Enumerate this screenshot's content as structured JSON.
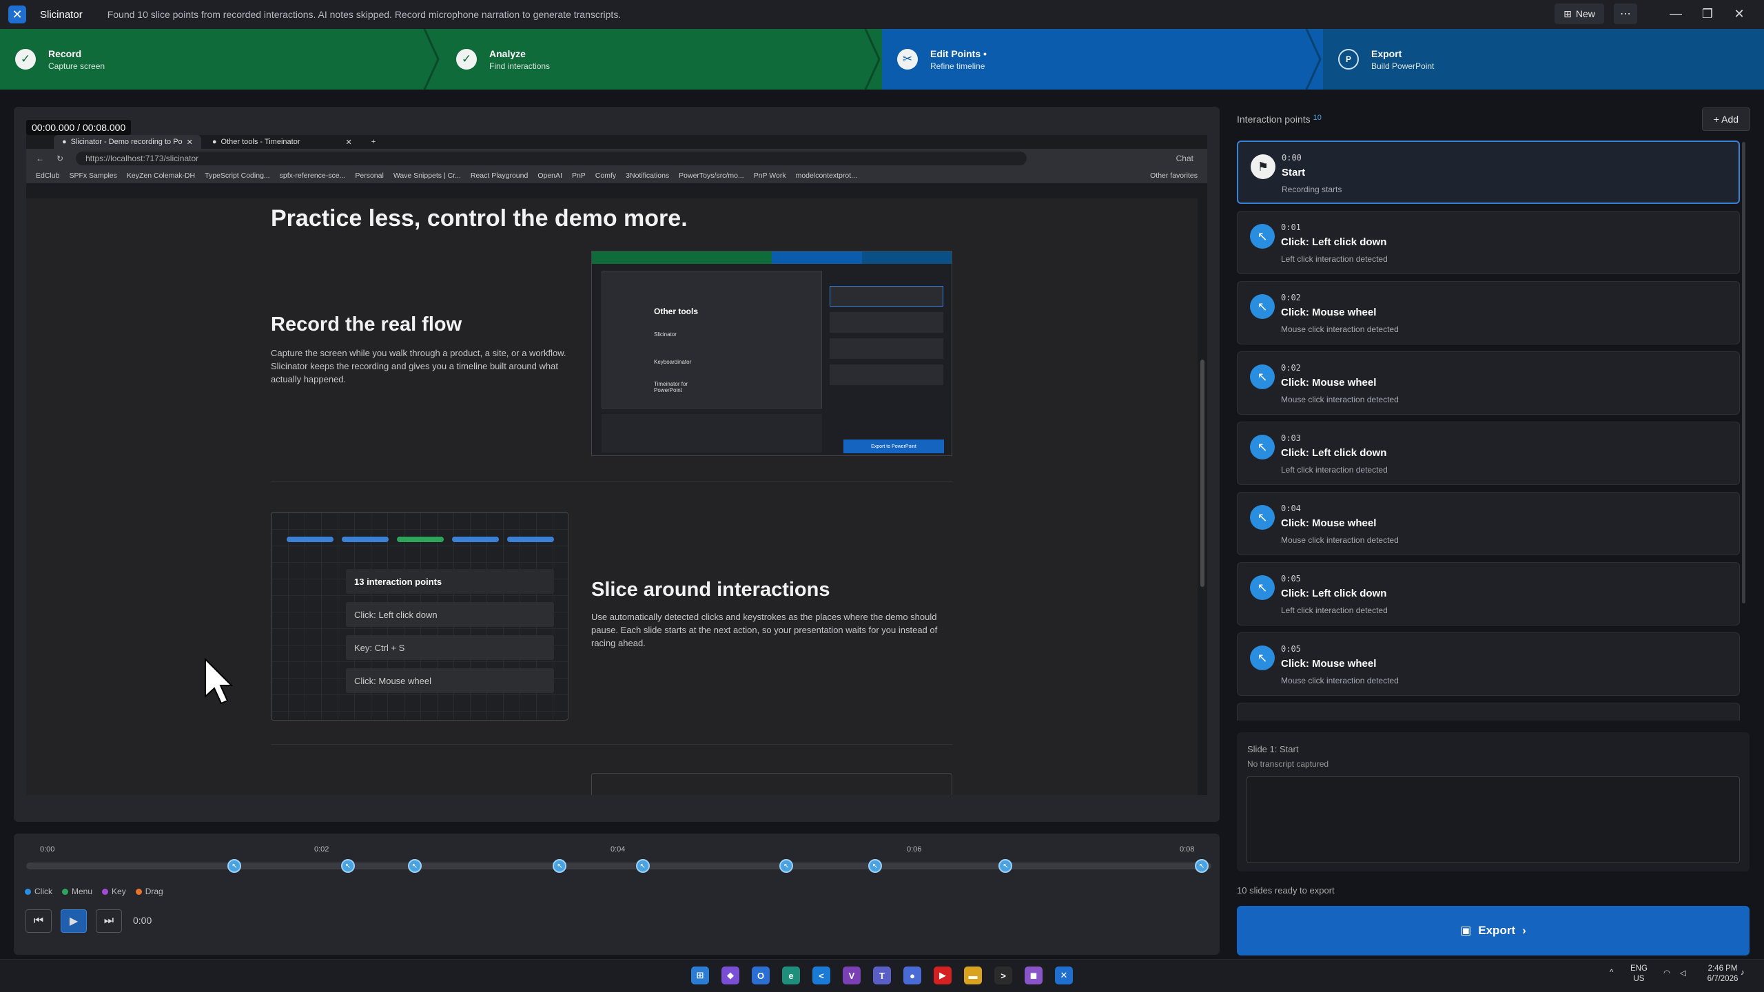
{
  "app": {
    "name": "Slicinator",
    "status": "Found 10 slice points from recorded interactions. AI notes skipped. Record microphone narration to generate transcripts.",
    "new_label": "New",
    "more_label": "⋯"
  },
  "steps": [
    {
      "title": "Record",
      "sub": "Capture screen",
      "icon": "check-icon"
    },
    {
      "title": "Analyze",
      "sub": "Find interactions",
      "icon": "check-icon"
    },
    {
      "title": "Edit Points •",
      "sub": "Refine timeline",
      "icon": "edit-icon"
    },
    {
      "title": "Export",
      "sub": "Build PowerPoint",
      "icon": "powerpoint-icon"
    }
  ],
  "colors": {
    "step_done": "#0f6b3a",
    "step_active": "#0b5cad",
    "step_pending": "#0a4f86",
    "accent": "#1565c0"
  },
  "player": {
    "time": "00:00.000 / 00:08.000"
  },
  "browser": {
    "tabs": [
      "Slicinator - Demo recording to Po",
      "Other tools - Timeinator"
    ],
    "url": "https://localhost:7173/slicinator",
    "favorites": [
      "EdClub",
      "SPFx Samples",
      "KeyZen Colemak-DH",
      "TypeScript Coding...",
      "spfx-reference-sce...",
      "Personal",
      "Wave Snippets | Cr...",
      "React Playground",
      "OpenAI",
      "PnP",
      "Comfy",
      "3Notifications",
      "PowerToys/src/mo...",
      "PnP Work",
      "modelcontextprot..."
    ],
    "other_favorites": "Other favorites",
    "chat": "Chat"
  },
  "page": {
    "headline": "Practice less, control the demo more.",
    "section1_title": "Record the real flow",
    "section1_text": "Capture the screen while you walk through a product, a site, or a workflow. Slicinator keeps the recording and gives you a timeline built around what actually happened.",
    "section2_title": "Slice around interactions",
    "section2_text": "Use automatically detected clicks and keystrokes as the places where the demo should pause. Each slide starts at the next action, so your presentation waits for you instead of racing ahead.",
    "card_items": [
      "13 interaction points",
      "Click: Left click down",
      "Key: Ctrl + S",
      "Click: Mouse wheel"
    ],
    "mini_shot": {
      "title": "Other tools",
      "items": [
        "Slicinator",
        "Keyboardinator",
        "Timeinator for PowerPoint"
      ],
      "export": "Export to PowerPoint"
    }
  },
  "timeline": {
    "labels": [
      "0:00",
      "0:02",
      "0:04",
      "0:06",
      "0:08"
    ],
    "markers_seconds": [
      1.34,
      2.12,
      2.58,
      3.58,
      4.15,
      5.14,
      5.75,
      6.65,
      8.0
    ],
    "duration_seconds": 8,
    "legend": [
      {
        "label": "Click",
        "color": "#2a8ee0"
      },
      {
        "label": "Menu",
        "color": "#2ea55a"
      },
      {
        "label": "Key",
        "color": "#a44bd6"
      },
      {
        "label": "Drag",
        "color": "#e8742a"
      }
    ],
    "current": "0:00"
  },
  "interaction_points": {
    "title": "Interaction points",
    "count": "10",
    "add_label": "+ Add",
    "items": [
      {
        "time": "0:00",
        "title": "Start",
        "sub": "Recording starts",
        "icon": "flag-icon"
      },
      {
        "time": "0:01",
        "title": "Click: Left click down",
        "sub": "Left click interaction detected",
        "icon": "click-icon"
      },
      {
        "time": "0:02",
        "title": "Click: Mouse wheel",
        "sub": "Mouse click interaction detected",
        "icon": "click-icon"
      },
      {
        "time": "0:02",
        "title": "Click: Mouse wheel",
        "sub": "Mouse click interaction detected",
        "icon": "click-icon"
      },
      {
        "time": "0:03",
        "title": "Click: Left click down",
        "sub": "Left click interaction detected",
        "icon": "click-icon"
      },
      {
        "time": "0:04",
        "title": "Click: Mouse wheel",
        "sub": "Mouse click interaction detected",
        "icon": "click-icon"
      },
      {
        "time": "0:05",
        "title": "Click: Left click down",
        "sub": "Left click interaction detected",
        "icon": "click-icon"
      },
      {
        "time": "0:05",
        "title": "Click: Mouse wheel",
        "sub": "Mouse click interaction detected",
        "icon": "click-icon"
      }
    ]
  },
  "slide": {
    "title": "Slide 1: Start",
    "sub": "No transcript captured",
    "ready": "10 slides ready to export",
    "export_label": "Export"
  },
  "taskbar": {
    "lang1": "ENG",
    "lang2": "US",
    "time": "2:46 PM",
    "date": "6/7/2026"
  }
}
